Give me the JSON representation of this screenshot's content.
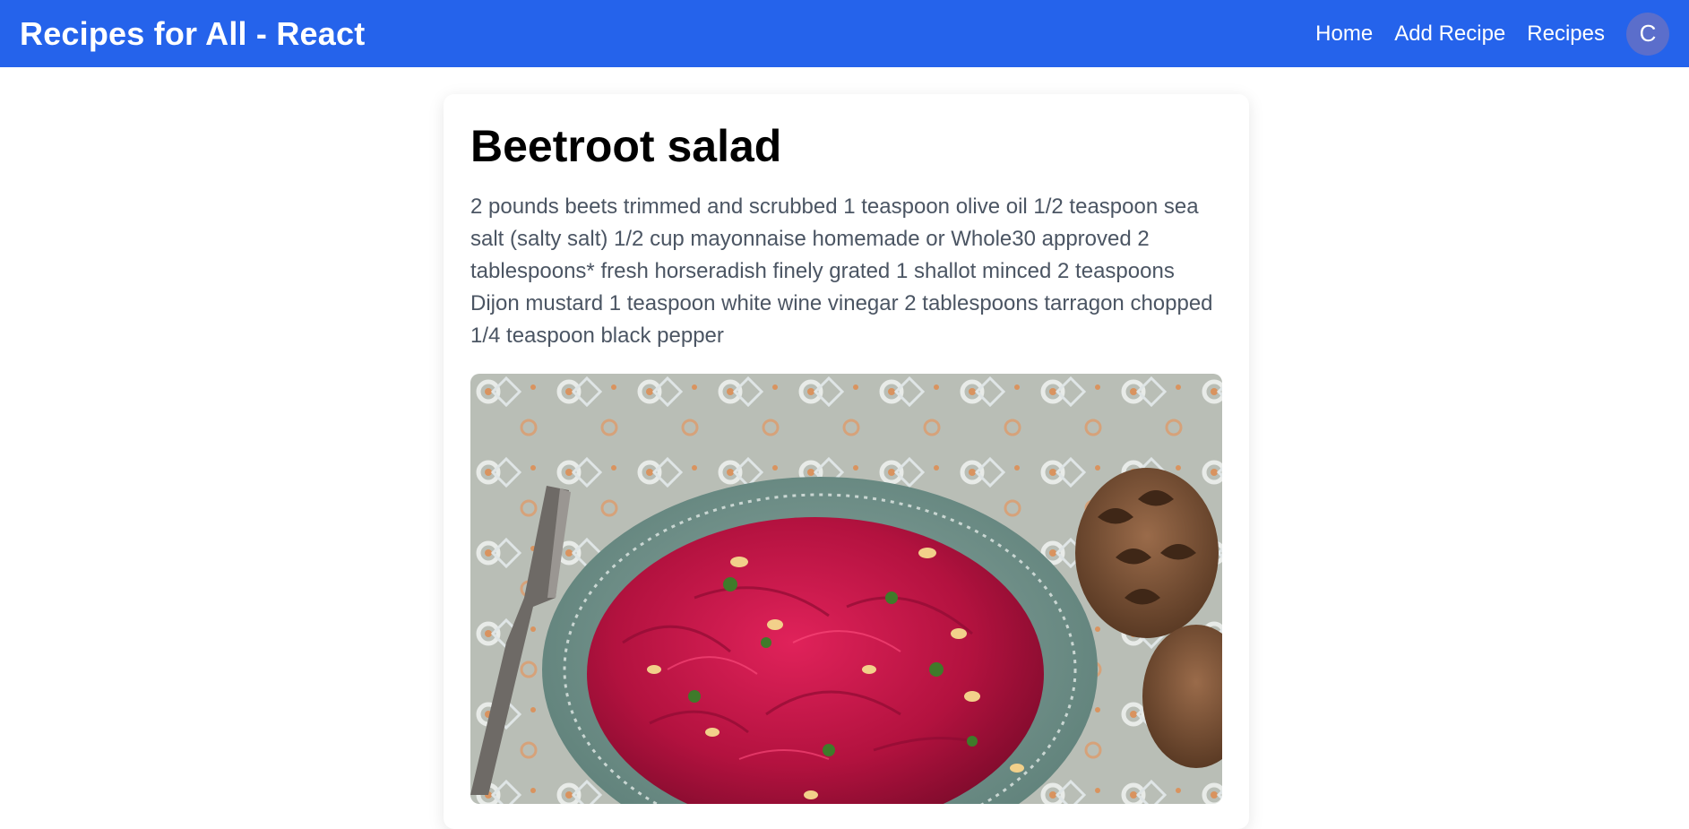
{
  "header": {
    "brand": "Recipes for All - React",
    "nav": [
      {
        "label": "Home"
      },
      {
        "label": "Add Recipe"
      },
      {
        "label": "Recipes"
      }
    ],
    "avatar_initial": "C"
  },
  "recipe": {
    "title": "Beetroot salad",
    "ingredients": "2 pounds beets trimmed and scrubbed 1 teaspoon olive oil 1/2 teaspoon sea salt (salty salt) 1/2 cup mayonnaise homemade or Whole30 approved 2 tablespoons* fresh horseradish finely grated 1 shallot minced 2 teaspoons Dijon mustard 1 teaspoon white wine vinegar 2 tablespoons tarragon chopped 1/4 teaspoon black pepper"
  },
  "colors": {
    "navbar": "#2563eb",
    "avatar": "#5b6ecb",
    "text_muted": "#4b5563"
  }
}
